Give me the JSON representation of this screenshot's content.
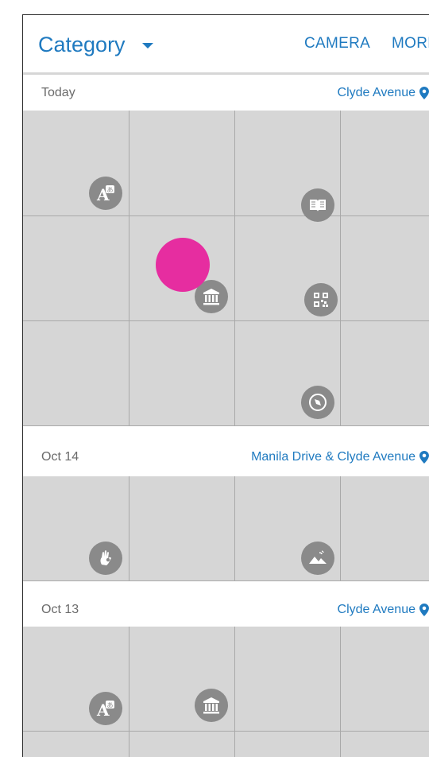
{
  "appbar": {
    "title": "Category",
    "actions": [
      "CAMERA",
      "MORE"
    ]
  },
  "sections": [
    {
      "date": "Today",
      "location": "Clyde Avenue"
    },
    {
      "date": "Oct 14",
      "location": "Manila Drive & Clyde Avenue"
    },
    {
      "date": "Oct 13",
      "location": "Clyde Avenue"
    }
  ],
  "icons": {
    "today": [
      "translate-icon",
      "book-icon",
      "museum-icon",
      "qr-code-icon",
      "compass-icon"
    ],
    "oct14": [
      "hand-gesture-icon",
      "landscape-icon"
    ],
    "oct13": [
      "translate-icon",
      "museum-icon"
    ]
  },
  "colors": {
    "accent": "#1f7ac0",
    "tile": "#d6d6d6",
    "badge": "#8a8a8a",
    "touch_indicator": "#e62da0"
  }
}
